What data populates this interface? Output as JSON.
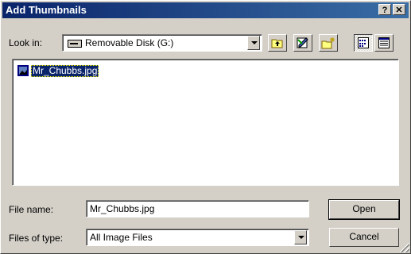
{
  "window": {
    "title": "Add Thumbnails",
    "help_glyph": "?",
    "close_glyph": "✕"
  },
  "toolbar": {
    "look_in_label": "Look in:",
    "location": "Removable Disk (G:)",
    "location_icon": "removable-disk-icon",
    "tools": [
      "up-one-level-icon",
      "desktop-icon",
      "new-folder-icon",
      "list-view-icon",
      "details-view-icon"
    ]
  },
  "file_list": {
    "items": [
      {
        "name": "Mr_Chubbs.jpg",
        "icon": "image-file-icon",
        "selected": true
      }
    ]
  },
  "form": {
    "file_name_label": "File name:",
    "file_name_value": "Mr_Chubbs.jpg",
    "file_type_label": "Files of type:",
    "file_type_value": "All Image Files"
  },
  "buttons": {
    "open": "Open",
    "cancel": "Cancel"
  },
  "colors": {
    "titlebar_start": "#0a246a",
    "titlebar_end": "#3a6ea5",
    "selection": "#0a246a",
    "face": "#d4d0c8"
  }
}
